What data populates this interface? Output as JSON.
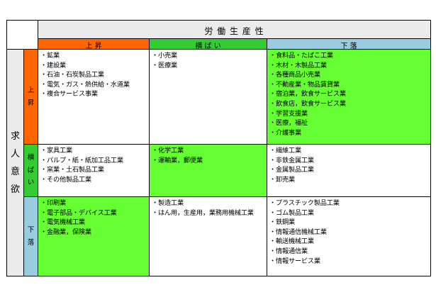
{
  "title": "労 働 生 産 性",
  "row_axis_label": [
    "求",
    "人",
    "意",
    "欲"
  ],
  "column_headers": [
    {
      "label": "上 昇",
      "color": "#ff6600"
    },
    {
      "label": "横 ば い",
      "color": "#33cc33"
    },
    {
      "label": "下 落",
      "color": "#99cce0"
    }
  ],
  "row_headers": [
    {
      "chars": [
        "上",
        "昇"
      ],
      "color": "#ff6600"
    },
    {
      "chars": [
        "横",
        "ば",
        "い"
      ],
      "color": "#33cc33"
    },
    {
      "chars": [
        "下",
        "落"
      ],
      "color": "#99cce0"
    }
  ],
  "cells": [
    [
      {
        "fill": "#ffffff",
        "items": [
          "・鉱業",
          "・建設業",
          "・石油・石炭製品工業",
          "・電気・ガス・熱供給・水道業",
          "・複合サービス事業"
        ]
      },
      {
        "fill": "#ffffff",
        "items": [
          "・小売業",
          "・医療業"
        ]
      },
      {
        "fill": "#66ff33",
        "items": [
          "・食料品・たばこ工業",
          "・木材・木製品工業",
          "・各種商品小売業",
          "・不動産業・物品賃貸業",
          "・宿泊業，飲食サービス業",
          "・飲食店，飲食サービス業",
          "・学習支援業",
          "・医療，福祉",
          "・介護事業"
        ]
      }
    ],
    [
      {
        "fill": "#ffffff",
        "items": [
          "・家具工業",
          "・パルプ・紙・紙加工品工業",
          "・窯業・土石製品工業",
          "・その他製品工業"
        ]
      },
      {
        "fill": "#66ff33",
        "items": [
          "・化学工業",
          "・運輸業，郵便業"
        ]
      },
      {
        "fill": "#ffffff",
        "items": [
          "・繊維工業",
          "・非鉄金属工業",
          "・金属製品工業",
          "・卸売業"
        ]
      }
    ],
    [
      {
        "fill": "#66ff33",
        "items": [
          "・印刷業",
          "・電子部品・デバイス工業",
          "・電気機械工業",
          "・金融業，保険業"
        ]
      },
      {
        "fill": "#ffffff",
        "items": [
          "・製造工業",
          "・はん用，生産用，業務用機械工業"
        ]
      },
      {
        "fill": "#ffffff",
        "items": [
          "・プラスチック製品工業",
          "・ゴム製品工業",
          "・鉄鋼業",
          "・情報通信機械工業",
          "・輸送機械工業",
          "・情報通信業",
          "・情報サービス業"
        ]
      }
    ]
  ]
}
